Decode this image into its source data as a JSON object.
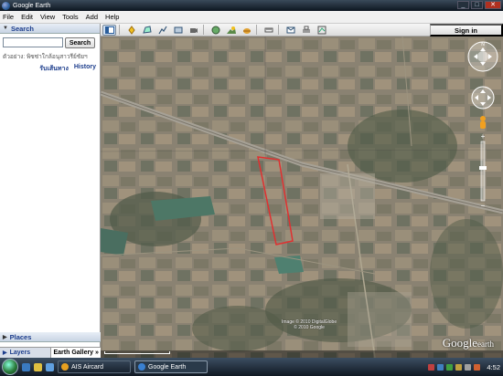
{
  "window": {
    "title": "Google Earth"
  },
  "menu": [
    "File",
    "Edit",
    "View",
    "Tools",
    "Add",
    "Help"
  ],
  "search": {
    "header": "Search",
    "input_value": "",
    "button_label": "Search",
    "example": "ตัวอย่าง: พิซซ่าใกล้อนุสาวรีย์ชัยฯ",
    "directions_link": "รับเส้นทาง",
    "history_link": "History"
  },
  "places": {
    "header": "Places"
  },
  "bottom_tabs": {
    "layers": "Layers",
    "gallery": "Earth Gallery »"
  },
  "toolbar": {
    "signin_label": "Sign in",
    "icons": [
      "sidebar-icon",
      "placemark-icon",
      "polygon-icon",
      "path-icon",
      "overlay-icon",
      "tour-icon",
      "historical-imagery-icon",
      "sunlight-icon",
      "planets-icon",
      "ruler-icon",
      "email-icon",
      "print-icon",
      "view-in-maps-icon"
    ]
  },
  "map": {
    "watermark_main": "Google",
    "watermark_sub": "earth",
    "imagery_credit": [
      "Image © 2010 DigitalGlobe",
      "© 2010 Google"
    ]
  },
  "taskbar": {
    "tasks": [
      {
        "label": "AIS Aircard",
        "icon": "aircard-icon",
        "active": false
      },
      {
        "label": "Google Earth",
        "icon": "google-earth-icon",
        "active": true
      }
    ],
    "clock": "4:52"
  },
  "colors": {
    "link": "#1c3d8c",
    "highlight_polygon": "#e03030",
    "panel_header": "#1c3d8c"
  }
}
